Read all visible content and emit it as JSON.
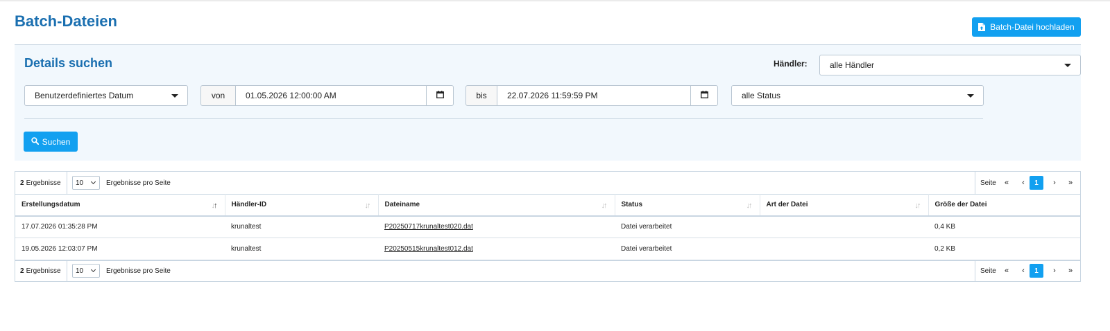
{
  "page": {
    "title": "Batch-Dateien",
    "upload_button": "Batch-Datei hochladen"
  },
  "search": {
    "title": "Details suchen",
    "merchant_label": "Händler:",
    "merchant_value": "alle Händler",
    "date_range_value": "Benutzerdefiniertes Datum",
    "from_label": "von",
    "from_value": "01.05.2026 12:00:00 AM",
    "to_label": "bis",
    "to_value": "22.07.2026 11:59:59 PM",
    "status_value": "alle Status",
    "search_button": "Suchen"
  },
  "results": {
    "count": "2",
    "count_label": "Ergebnisse",
    "per_page_value": "10",
    "per_page_label": "Ergebnisse pro Seite",
    "page_label": "Seite",
    "first": "«",
    "prev": "‹",
    "current_page": "1",
    "next": "›",
    "last": "»",
    "columns": [
      "Erstellungsdatum",
      "Händler-ID",
      "Dateiname",
      "Status",
      "Art der Datei",
      "Größe der Datei"
    ],
    "rows": [
      {
        "date": "17.07.2026 01:35:28 PM",
        "merchant": "krunaltest",
        "file": "P20250717krunaltest020.dat",
        "status": "Datei verarbeitet",
        "type": "",
        "size": "0,4 KB"
      },
      {
        "date": "19.05.2026 12:03:07 PM",
        "merchant": "krunaltest",
        "file": "P20250515krunaltest012.dat",
        "status": "Datei verarbeitet",
        "type": "",
        "size": "0,2 KB"
      }
    ]
  },
  "colors": {
    "accent": "#12a0f0",
    "title": "#1a6fb0",
    "panel_bg": "#f2f8fd"
  },
  "icons": {
    "upload": "file-upload-icon",
    "calendar": "calendar-icon",
    "search": "search-icon",
    "caret": "caret-down-icon"
  }
}
